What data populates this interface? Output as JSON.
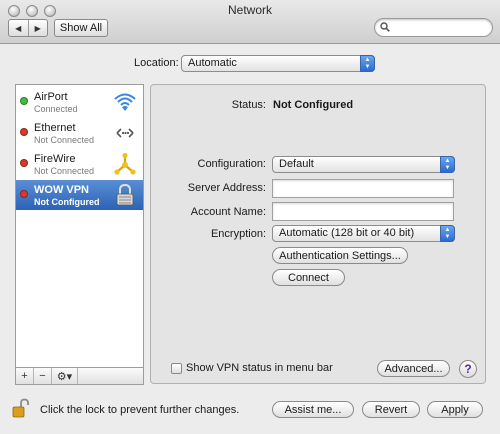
{
  "window": {
    "title": "Network"
  },
  "toolbar": {
    "back_label": "◀",
    "forward_label": "▶",
    "show_all_label": "Show All",
    "search_value": ""
  },
  "location": {
    "label": "Location:",
    "value": "Automatic"
  },
  "services": [
    {
      "name": "AirPort",
      "status": "Connected",
      "dot_color": "#3fbf3f",
      "icon": "wifi-icon"
    },
    {
      "name": "Ethernet",
      "status": "Not Connected",
      "dot_color": "#d93a2a",
      "icon": "ethernet-icon"
    },
    {
      "name": "FireWire",
      "status": "Not Connected",
      "dot_color": "#d93a2a",
      "icon": "firewire-icon"
    },
    {
      "name": "WOW VPN",
      "status": "Not Configured",
      "dot_color": "#d93a2a",
      "icon": "vpn-lock-icon",
      "selected": true
    }
  ],
  "list_tools": {
    "add": "+",
    "remove": "−",
    "gear": "⚙▾"
  },
  "detail": {
    "status_label": "Status:",
    "status_value": "Not Configured",
    "configuration_label": "Configuration:",
    "configuration_value": "Default",
    "server_label": "Server Address:",
    "server_value": "",
    "account_label": "Account Name:",
    "account_value": "",
    "encryption_label": "Encryption:",
    "encryption_value": "Automatic (128 bit or 40 bit)",
    "auth_button": "Authentication Settings...",
    "connect_button": "Connect",
    "show_vpn_label": "Show VPN status in menu bar",
    "show_vpn_checked": false,
    "advanced_button": "Advanced...",
    "help_label": "?"
  },
  "bottom": {
    "lock_text": "Click the lock to prevent further changes.",
    "assist_button": "Assist me...",
    "revert_button": "Revert",
    "apply_button": "Apply"
  },
  "colors": {
    "selection": "#3a6fc4",
    "connected": "#3fbf3f",
    "disconnected": "#d93a2a"
  }
}
